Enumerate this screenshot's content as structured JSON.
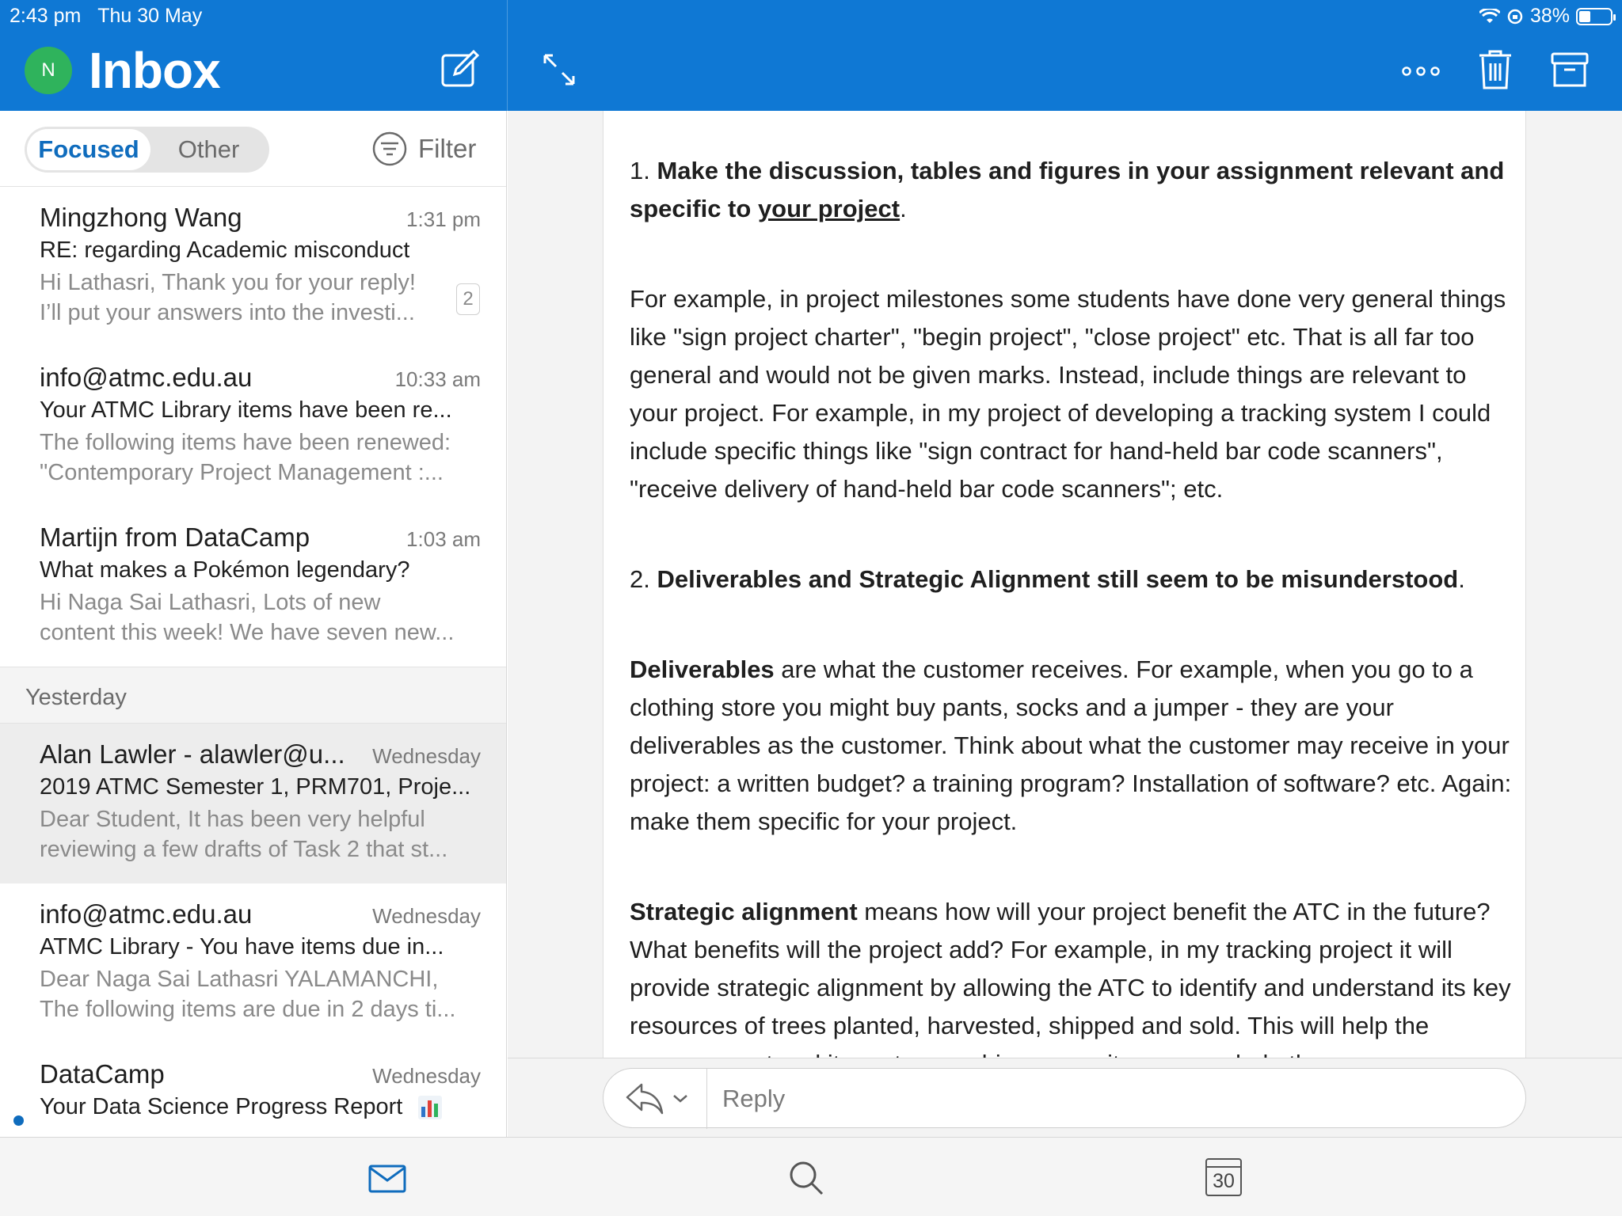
{
  "status": {
    "time": "2:43 pm",
    "date": "Thu 30 May",
    "battery": "38%"
  },
  "header": {
    "avatar_initial": "N",
    "title": "Inbox"
  },
  "tabs": {
    "focused": "Focused",
    "other": "Other",
    "filter": "Filter"
  },
  "messages": [
    {
      "sender": "Mingzhong Wang",
      "time": "1:31 pm",
      "subject": "RE: regarding Academic misconduct",
      "preview1": "Hi Lathasri, Thank you for your reply!",
      "preview2": "I’ll put your answers into the investi...",
      "count": "2"
    },
    {
      "sender": "info@atmc.edu.au",
      "time": "10:33 am",
      "subject": "Your ATMC Library items have been re...",
      "preview1": "The following items have been renewed:",
      "preview2": "\"Contemporary Project Management :..."
    },
    {
      "sender": "Martijn from DataCamp",
      "time": "1:03 am",
      "subject": "What makes a Pokémon legendary?",
      "preview1": "Hi Naga Sai Lathasri, Lots of new",
      "preview2": "content this week! We have seven new..."
    },
    {
      "sender": "Alan Lawler - alawler@u...",
      "time": "Wednesday",
      "subject": "2019 ATMC Semester 1, PRM701, Proje...",
      "preview1": "Dear Student, It has been very helpful",
      "preview2": "reviewing a few drafts of Task 2 that st..."
    },
    {
      "sender": "info@atmc.edu.au",
      "time": "Wednesday",
      "subject": "ATMC Library - You have items due in...",
      "preview1": "Dear Naga Sai Lathasri YALAMANCHI,",
      "preview2": "The following items are due in 2 days ti..."
    },
    {
      "sender": "DataCamp",
      "time": "Wednesday",
      "subject": "Your Data Science Progress Report",
      "preview1": "",
      "preview2": ""
    }
  ],
  "section_label": "Yesterday",
  "body": {
    "p1_num": "1. ",
    "p1_bold": "Make the discussion, tables and figures in your assignment relevant and specific to ",
    "p1_underline": "your project",
    "p1_end": ".",
    "p2": "For example, in project milestones some students have done very general things like \"sign project charter\", \"begin project\", \"close project\" etc. That is all far too general and would not be given marks. Instead, include things are relevant to your project. For example, in my project of developing a tracking system I could include specific things like \"sign contract for hand-held bar code scanners\", \"receive delivery of hand-held bar code scanners\"; etc.",
    "p3_num": "2. ",
    "p3_bold": "Deliverables and Strategic Alignment still seem to be misunderstood",
    "p3_end": ".",
    "p4_bold": "Deliverables",
    "p4_rest": " are what the customer receives. For example, when you go to a clothing store you might buy pants, socks and a jumper - they are your deliverables as the customer. Think about what the customer may receive in your project: a written budget? a training program? Installation of software? etc. Again: make them specific for your project.",
    "p5_bold": "Strategic alignment",
    "p5_rest": " means how will your project benefit the ATC in the future? What benefits will the project add? For example, in my tracking project it will provide strategic alignment by allowing the ATC to identify and understand its key resources of trees planted, harvested, shipped and sold. This will help the management and its partners achieve security across whole the"
  },
  "reply": {
    "label": "Reply"
  },
  "tabbar": {
    "calendar_day": "30"
  },
  "colors": {
    "brand": "#0f78d4",
    "avatar": "#2fb35c",
    "accent": "#0f6cbd"
  }
}
